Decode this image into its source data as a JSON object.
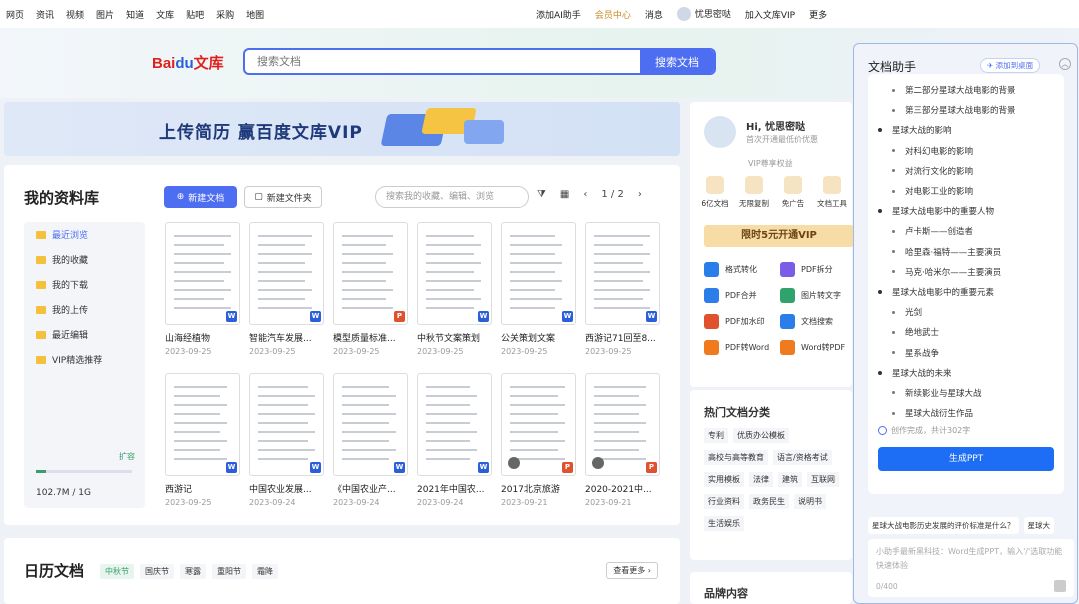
{
  "topnav": {
    "left": [
      "网页",
      "资讯",
      "视频",
      "图片",
      "知道",
      "文库",
      "贴吧",
      "采购",
      "地图"
    ],
    "ai": "添加AI助手",
    "member": "会员中心",
    "msg": "消息",
    "user": "忧思密哒",
    "vip": "加入文库VIP",
    "more": "更多"
  },
  "search": {
    "placeholder": "搜索文档",
    "button": "搜索文档"
  },
  "logo": "Bai du 文库",
  "banner": {
    "text": "上传简历  赢百度文库VIP"
  },
  "library": {
    "title": "我的资料库",
    "new_doc": "新建文档",
    "new_folder": "新建文件夹",
    "search_placeholder": "搜索我的收藏、编辑、浏览",
    "page": "1 / 2",
    "side": [
      "最近浏览",
      "我的收藏",
      "我的下载",
      "我的上传",
      "最近编辑",
      "VIP精选推荐"
    ],
    "storage_text": "102.7M / 1G",
    "storage_fraction": 0.1,
    "expand": "扩容",
    "docs": [
      {
        "name": "山海经植物",
        "date": "2023-09-25",
        "type": "W"
      },
      {
        "name": "智能汽车发展...",
        "date": "2023-09-25",
        "type": "W"
      },
      {
        "name": "模型质量标准...",
        "date": "2023-09-25",
        "type": "P"
      },
      {
        "name": "中秋节文案策划",
        "date": "2023-09-25",
        "type": "W"
      },
      {
        "name": "公关策划文案",
        "date": "2023-09-25",
        "type": "W"
      },
      {
        "name": "西游记71回至8...",
        "date": "2023-09-25",
        "type": "W"
      },
      {
        "name": "西游记",
        "date": "2023-09-25",
        "type": "W"
      },
      {
        "name": "中国农业发展...",
        "date": "2023-09-24",
        "type": "W"
      },
      {
        "name": "《中国农业产...",
        "date": "2023-09-24",
        "type": "W"
      },
      {
        "name": "2021年中国农...",
        "date": "2023-09-24",
        "type": "W"
      },
      {
        "name": "2017北京旅游",
        "date": "2023-09-21",
        "type": "P"
      },
      {
        "name": "2020-2021中...",
        "date": "2023-09-21",
        "type": "P"
      }
    ]
  },
  "calendar": {
    "title": "日历文档",
    "tags": [
      "中秋节",
      "国庆节",
      "寒露",
      "重阳节",
      "霜降"
    ],
    "more": "查看更多 ›"
  },
  "profile": {
    "hi": "Hi, 忧思密哒",
    "sub": "首次开通最低价优惠",
    "vip_rights": "VIP尊享权益",
    "icons": [
      "6亿文档",
      "无限复制",
      "免广告",
      "文档工具"
    ],
    "vip_button": "限时5元开通VIP",
    "tools": [
      "格式转化",
      "PDF拆分",
      "PDF合并",
      "图片转文字",
      "PDF加水印",
      "文档搜索",
      "PDF转Word",
      "Word转PDF"
    ]
  },
  "hot": {
    "title": "热门文档分类",
    "tags": [
      "专利",
      "优质办公模板",
      "高校与高等教育",
      "语言/资格考试",
      "实用模板",
      "法律",
      "建筑",
      "互联网",
      "行业资料",
      "政务民生",
      "说明书",
      "生活娱乐"
    ]
  },
  "brand": {
    "title": "品牌内容"
  },
  "assistant": {
    "title": "文档助手",
    "pin": "添加到桌面",
    "outline": [
      {
        "lv": 2,
        "t": "第二部分星球大战电影的背景"
      },
      {
        "lv": 2,
        "t": "第三部分星球大战电影的背景"
      },
      {
        "lv": 1,
        "t": "星球大战的影响"
      },
      {
        "lv": 2,
        "t": "对科幻电影的影响"
      },
      {
        "lv": 2,
        "t": "对流行文化的影响"
      },
      {
        "lv": 2,
        "t": "对电影工业的影响"
      },
      {
        "lv": 1,
        "t": "星球大战电影中的重要人物"
      },
      {
        "lv": 2,
        "t": "卢卡斯——创造者"
      },
      {
        "lv": 2,
        "t": "哈里森·福特——主要演员"
      },
      {
        "lv": 2,
        "t": "马克·哈米尔——主要演员"
      },
      {
        "lv": 1,
        "t": "星球大战电影中的重要元素"
      },
      {
        "lv": 2,
        "t": "光剑"
      },
      {
        "lv": 2,
        "t": "绝地武士"
      },
      {
        "lv": 2,
        "t": "星系战争"
      },
      {
        "lv": 1,
        "t": "星球大战的未来"
      },
      {
        "lv": 2,
        "t": "新续影业与星球大战"
      },
      {
        "lv": 2,
        "t": "星球大战衍生作品"
      }
    ],
    "done": "创作完成，共计302字",
    "generate": "生成PPT",
    "suggestions": [
      "星球大战电影历史发展的评价标准是什么？",
      "星球大"
    ],
    "input_placeholder": "小助手最新黑科技：Word生成PPT，输入'/'选取功能快速体验",
    "count": "0/400"
  }
}
